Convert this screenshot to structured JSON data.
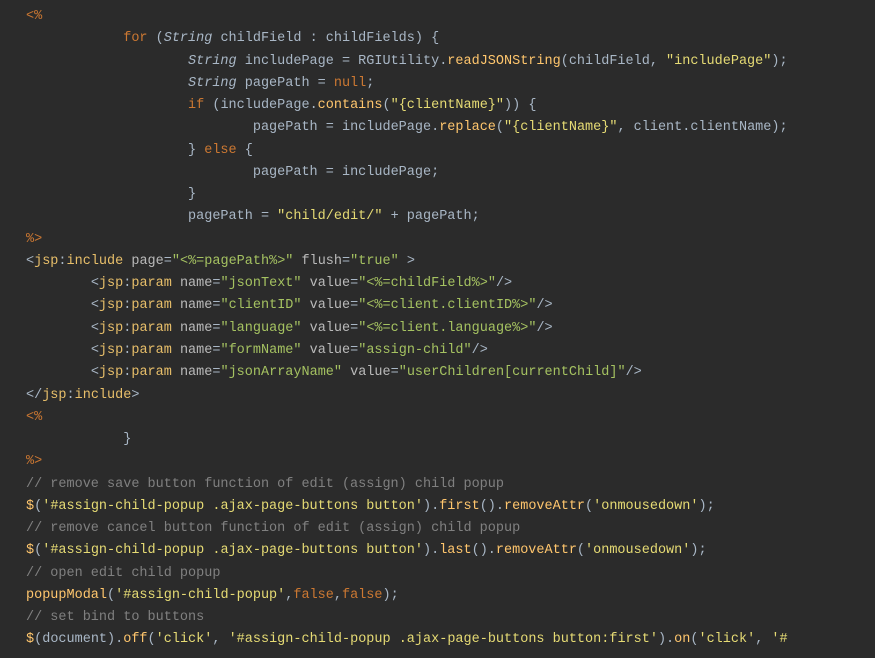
{
  "lines": [
    {
      "indent": 0,
      "parts": [
        {
          "cls": "tag-brk",
          "t": "<%"
        }
      ]
    },
    {
      "indent": 3,
      "parts": [
        {
          "cls": "keyword",
          "t": "for"
        },
        {
          "cls": "punct",
          "t": " ("
        },
        {
          "cls": "type",
          "t": "String"
        },
        {
          "cls": "ident",
          "t": " childField "
        },
        {
          "cls": "punct",
          "t": ": "
        },
        {
          "cls": "ident",
          "t": "childFields"
        },
        {
          "cls": "punct",
          "t": ") {"
        }
      ]
    },
    {
      "indent": 5,
      "parts": [
        {
          "cls": "type",
          "t": "String"
        },
        {
          "cls": "ident",
          "t": " includePage "
        },
        {
          "cls": "punct",
          "t": "= "
        },
        {
          "cls": "ident",
          "t": "RGIUtility"
        },
        {
          "cls": "dot",
          "t": "."
        },
        {
          "cls": "method",
          "t": "readJSONString"
        },
        {
          "cls": "punct",
          "t": "("
        },
        {
          "cls": "ident",
          "t": "childField"
        },
        {
          "cls": "punct",
          "t": ", "
        },
        {
          "cls": "string",
          "t": "\"includePage\""
        },
        {
          "cls": "punct",
          "t": ");"
        }
      ]
    },
    {
      "indent": 5,
      "parts": [
        {
          "cls": "type",
          "t": "String"
        },
        {
          "cls": "ident",
          "t": " pagePath "
        },
        {
          "cls": "punct",
          "t": "= "
        },
        {
          "cls": "keyword",
          "t": "null"
        },
        {
          "cls": "punct",
          "t": ";"
        }
      ]
    },
    {
      "indent": 5,
      "parts": [
        {
          "cls": "keyword",
          "t": "if"
        },
        {
          "cls": "punct",
          "t": " ("
        },
        {
          "cls": "ident",
          "t": "includePage"
        },
        {
          "cls": "dot",
          "t": "."
        },
        {
          "cls": "method",
          "t": "contains"
        },
        {
          "cls": "punct",
          "t": "("
        },
        {
          "cls": "string",
          "t": "\"{clientName}\""
        },
        {
          "cls": "punct",
          "t": ")) {"
        }
      ]
    },
    {
      "indent": 7,
      "parts": [
        {
          "cls": "ident",
          "t": "pagePath "
        },
        {
          "cls": "punct",
          "t": "= "
        },
        {
          "cls": "ident",
          "t": "includePage"
        },
        {
          "cls": "dot",
          "t": "."
        },
        {
          "cls": "method",
          "t": "replace"
        },
        {
          "cls": "punct",
          "t": "("
        },
        {
          "cls": "string",
          "t": "\"{clientName}\""
        },
        {
          "cls": "punct",
          "t": ", "
        },
        {
          "cls": "ident",
          "t": "client"
        },
        {
          "cls": "dot",
          "t": "."
        },
        {
          "cls": "ident",
          "t": "clientName"
        },
        {
          "cls": "punct",
          "t": ");"
        }
      ]
    },
    {
      "indent": 5,
      "parts": [
        {
          "cls": "punct",
          "t": "} "
        },
        {
          "cls": "keyword",
          "t": "else"
        },
        {
          "cls": "punct",
          "t": " {"
        }
      ]
    },
    {
      "indent": 7,
      "parts": [
        {
          "cls": "ident",
          "t": "pagePath "
        },
        {
          "cls": "punct",
          "t": "= "
        },
        {
          "cls": "ident",
          "t": "includePage"
        },
        {
          "cls": "punct",
          "t": ";"
        }
      ]
    },
    {
      "indent": 5,
      "parts": [
        {
          "cls": "punct",
          "t": "}"
        }
      ]
    },
    {
      "indent": 5,
      "parts": [
        {
          "cls": "ident",
          "t": "pagePath "
        },
        {
          "cls": "punct",
          "t": "= "
        },
        {
          "cls": "string",
          "t": "\"child/edit/\""
        },
        {
          "cls": "punct",
          "t": " + "
        },
        {
          "cls": "ident",
          "t": "pagePath"
        },
        {
          "cls": "punct",
          "t": ";"
        }
      ]
    },
    {
      "indent": 0,
      "parts": [
        {
          "cls": "tag-brk",
          "t": "%>"
        }
      ]
    },
    {
      "indent": 0,
      "parts": [
        {
          "cls": "punct",
          "t": "<"
        },
        {
          "cls": "tag-name",
          "t": "jsp"
        },
        {
          "cls": "punct",
          "t": ":"
        },
        {
          "cls": "tag-name",
          "t": "include"
        },
        {
          "cls": "attr-name",
          "t": " page"
        },
        {
          "cls": "punct",
          "t": "="
        },
        {
          "cls": "attr-val",
          "t": "\"<%=pagePath%>\""
        },
        {
          "cls": "attr-name",
          "t": " flush"
        },
        {
          "cls": "punct",
          "t": "="
        },
        {
          "cls": "attr-val",
          "t": "\"true\""
        },
        {
          "cls": "punct",
          "t": " >"
        }
      ]
    },
    {
      "indent": 2,
      "parts": [
        {
          "cls": "punct",
          "t": "<"
        },
        {
          "cls": "tag-name",
          "t": "jsp"
        },
        {
          "cls": "punct",
          "t": ":"
        },
        {
          "cls": "tag-name",
          "t": "param"
        },
        {
          "cls": "attr-name",
          "t": " name"
        },
        {
          "cls": "punct",
          "t": "="
        },
        {
          "cls": "attr-val",
          "t": "\"jsonText\""
        },
        {
          "cls": "attr-name",
          "t": " value"
        },
        {
          "cls": "punct",
          "t": "="
        },
        {
          "cls": "attr-val",
          "t": "\"<%=childField%>\""
        },
        {
          "cls": "punct",
          "t": "/>"
        }
      ]
    },
    {
      "indent": 2,
      "parts": [
        {
          "cls": "punct",
          "t": "<"
        },
        {
          "cls": "tag-name",
          "t": "jsp"
        },
        {
          "cls": "punct",
          "t": ":"
        },
        {
          "cls": "tag-name",
          "t": "param"
        },
        {
          "cls": "attr-name",
          "t": " name"
        },
        {
          "cls": "punct",
          "t": "="
        },
        {
          "cls": "attr-val",
          "t": "\"clientID\""
        },
        {
          "cls": "attr-name",
          "t": " value"
        },
        {
          "cls": "punct",
          "t": "="
        },
        {
          "cls": "attr-val",
          "t": "\"<%=client.clientID%>\""
        },
        {
          "cls": "punct",
          "t": "/>"
        }
      ]
    },
    {
      "indent": 2,
      "parts": [
        {
          "cls": "punct",
          "t": "<"
        },
        {
          "cls": "tag-name",
          "t": "jsp"
        },
        {
          "cls": "punct",
          "t": ":"
        },
        {
          "cls": "tag-name",
          "t": "param"
        },
        {
          "cls": "attr-name",
          "t": " name"
        },
        {
          "cls": "punct",
          "t": "="
        },
        {
          "cls": "attr-val",
          "t": "\"language\""
        },
        {
          "cls": "attr-name",
          "t": " value"
        },
        {
          "cls": "punct",
          "t": "="
        },
        {
          "cls": "attr-val",
          "t": "\"<%=client.language%>\""
        },
        {
          "cls": "punct",
          "t": "/>"
        }
      ]
    },
    {
      "indent": 2,
      "parts": [
        {
          "cls": "punct",
          "t": "<"
        },
        {
          "cls": "tag-name",
          "t": "jsp"
        },
        {
          "cls": "punct",
          "t": ":"
        },
        {
          "cls": "tag-name",
          "t": "param"
        },
        {
          "cls": "attr-name",
          "t": " name"
        },
        {
          "cls": "punct",
          "t": "="
        },
        {
          "cls": "attr-val",
          "t": "\"formName\""
        },
        {
          "cls": "attr-name",
          "t": " value"
        },
        {
          "cls": "punct",
          "t": "="
        },
        {
          "cls": "attr-val",
          "t": "\"assign-child\""
        },
        {
          "cls": "punct",
          "t": "/>"
        }
      ]
    },
    {
      "indent": 2,
      "parts": [
        {
          "cls": "punct",
          "t": "<"
        },
        {
          "cls": "tag-name",
          "t": "jsp"
        },
        {
          "cls": "punct",
          "t": ":"
        },
        {
          "cls": "tag-name",
          "t": "param"
        },
        {
          "cls": "attr-name",
          "t": " name"
        },
        {
          "cls": "punct",
          "t": "="
        },
        {
          "cls": "attr-val",
          "t": "\"jsonArrayName\""
        },
        {
          "cls": "attr-name",
          "t": " value"
        },
        {
          "cls": "punct",
          "t": "="
        },
        {
          "cls": "attr-val",
          "t": "\"userChildren[currentChild]\""
        },
        {
          "cls": "punct",
          "t": "/>"
        }
      ]
    },
    {
      "indent": 0,
      "parts": [
        {
          "cls": "punct",
          "t": "</"
        },
        {
          "cls": "tag-name",
          "t": "jsp"
        },
        {
          "cls": "punct",
          "t": ":"
        },
        {
          "cls": "tag-name",
          "t": "include"
        },
        {
          "cls": "punct",
          "t": ">"
        }
      ]
    },
    {
      "indent": 0,
      "parts": [
        {
          "cls": "tag-brk",
          "t": "<%"
        }
      ]
    },
    {
      "indent": 3,
      "parts": [
        {
          "cls": "punct",
          "t": "}"
        }
      ]
    },
    {
      "indent": 0,
      "parts": [
        {
          "cls": "tag-brk",
          "t": "%>"
        }
      ]
    },
    {
      "indent": 0,
      "parts": [
        {
          "cls": "punct",
          "t": ""
        }
      ]
    },
    {
      "indent": 0,
      "parts": [
        {
          "cls": "comment",
          "t": "// remove save button function of edit (assign) child popup"
        }
      ]
    },
    {
      "indent": 0,
      "parts": [
        {
          "cls": "jq",
          "t": "$"
        },
        {
          "cls": "punct",
          "t": "("
        },
        {
          "cls": "string",
          "t": "'#assign-child-popup .ajax-page-buttons button'"
        },
        {
          "cls": "punct",
          "t": ")."
        },
        {
          "cls": "method",
          "t": "first"
        },
        {
          "cls": "punct",
          "t": "()."
        },
        {
          "cls": "method",
          "t": "removeAttr"
        },
        {
          "cls": "punct",
          "t": "("
        },
        {
          "cls": "string",
          "t": "'onmousedown'"
        },
        {
          "cls": "punct",
          "t": ");"
        }
      ]
    },
    {
      "indent": 0,
      "parts": [
        {
          "cls": "comment",
          "t": "// remove cancel button function of edit (assign) child popup"
        }
      ]
    },
    {
      "indent": 0,
      "parts": [
        {
          "cls": "jq",
          "t": "$"
        },
        {
          "cls": "punct",
          "t": "("
        },
        {
          "cls": "string",
          "t": "'#assign-child-popup .ajax-page-buttons button'"
        },
        {
          "cls": "punct",
          "t": ")."
        },
        {
          "cls": "method",
          "t": "last"
        },
        {
          "cls": "punct",
          "t": "()."
        },
        {
          "cls": "method",
          "t": "removeAttr"
        },
        {
          "cls": "punct",
          "t": "("
        },
        {
          "cls": "string",
          "t": "'onmousedown'"
        },
        {
          "cls": "punct",
          "t": ");"
        }
      ]
    },
    {
      "indent": 0,
      "parts": [
        {
          "cls": "comment",
          "t": "// open edit child popup"
        }
      ]
    },
    {
      "indent": 0,
      "parts": [
        {
          "cls": "method",
          "t": "popupModal"
        },
        {
          "cls": "punct",
          "t": "("
        },
        {
          "cls": "string",
          "t": "'#assign-child-popup'"
        },
        {
          "cls": "punct",
          "t": ","
        },
        {
          "cls": "bool",
          "t": "false"
        },
        {
          "cls": "punct",
          "t": ","
        },
        {
          "cls": "bool",
          "t": "false"
        },
        {
          "cls": "punct",
          "t": ");"
        }
      ]
    },
    {
      "indent": 0,
      "parts": [
        {
          "cls": "comment",
          "t": "// set bind to buttons"
        }
      ]
    },
    {
      "indent": 0,
      "parts": [
        {
          "cls": "jq",
          "t": "$"
        },
        {
          "cls": "punct",
          "t": "("
        },
        {
          "cls": "ident",
          "t": "document"
        },
        {
          "cls": "punct",
          "t": ")."
        },
        {
          "cls": "method",
          "t": "off"
        },
        {
          "cls": "punct",
          "t": "("
        },
        {
          "cls": "string",
          "t": "'click'"
        },
        {
          "cls": "punct",
          "t": ", "
        },
        {
          "cls": "string",
          "t": "'#assign-child-popup .ajax-page-buttons button:first'"
        },
        {
          "cls": "punct",
          "t": ")."
        },
        {
          "cls": "method",
          "t": "on"
        },
        {
          "cls": "punct",
          "t": "("
        },
        {
          "cls": "string",
          "t": "'click'"
        },
        {
          "cls": "punct",
          "t": ", "
        },
        {
          "cls": "string",
          "t": "'#"
        }
      ]
    }
  ]
}
